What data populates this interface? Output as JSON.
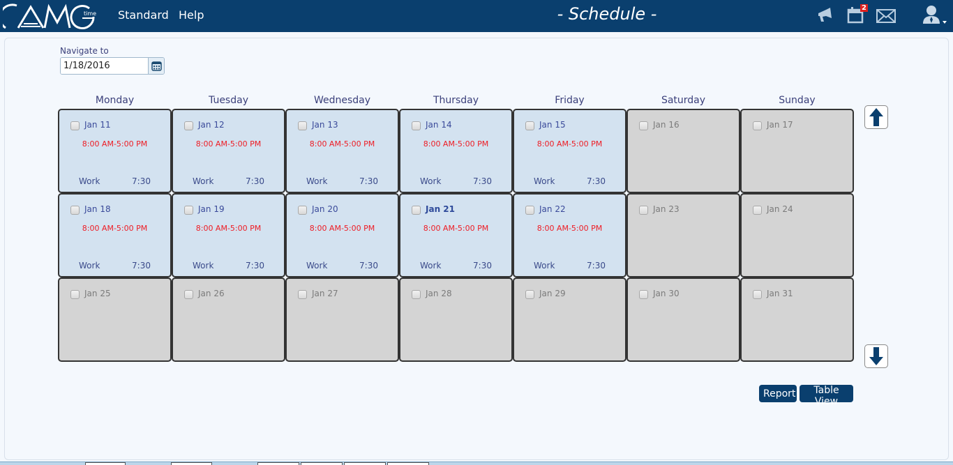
{
  "header": {
    "logo_text": "AMG",
    "logo_sub": "time",
    "nav": [
      "Standard",
      "Help"
    ],
    "title": "- Schedule -",
    "icons": {
      "announcements": "megaphone-icon",
      "calendar": "calendar-icon",
      "calendar_badge": "2",
      "messages": "envelope-icon",
      "user": "user-icon"
    }
  },
  "navigate": {
    "label": "Navigate to",
    "value": "1/18/2016"
  },
  "days": [
    "Monday",
    "Tuesday",
    "Wednesday",
    "Thursday",
    "Friday",
    "Saturday",
    "Sunday"
  ],
  "weeks": [
    [
      {
        "date": "Jan 11",
        "type": "work",
        "shift": "8:00 AM-5:00 PM",
        "wtype": "Work",
        "hours": "7:30"
      },
      {
        "date": "Jan 12",
        "type": "work",
        "shift": "8:00 AM-5:00 PM",
        "wtype": "Work",
        "hours": "7:30"
      },
      {
        "date": "Jan 13",
        "type": "work",
        "shift": "8:00 AM-5:00 PM",
        "wtype": "Work",
        "hours": "7:30"
      },
      {
        "date": "Jan 14",
        "type": "work",
        "shift": "8:00 AM-5:00 PM",
        "wtype": "Work",
        "hours": "7:30"
      },
      {
        "date": "Jan 15",
        "type": "work",
        "shift": "8:00 AM-5:00 PM",
        "wtype": "Work",
        "hours": "7:30"
      },
      {
        "date": "Jan 16",
        "type": "off"
      },
      {
        "date": "Jan 17",
        "type": "off"
      }
    ],
    [
      {
        "date": "Jan 18",
        "type": "work",
        "shift": "8:00 AM-5:00 PM",
        "wtype": "Work",
        "hours": "7:30"
      },
      {
        "date": "Jan 19",
        "type": "work",
        "shift": "8:00 AM-5:00 PM",
        "wtype": "Work",
        "hours": "7:30"
      },
      {
        "date": "Jan 20",
        "type": "work",
        "shift": "8:00 AM-5:00 PM",
        "wtype": "Work",
        "hours": "7:30"
      },
      {
        "date": "Jan 21",
        "type": "work",
        "shift": "8:00 AM-5:00 PM",
        "wtype": "Work",
        "hours": "7:30",
        "today": true
      },
      {
        "date": "Jan 22",
        "type": "work",
        "shift": "8:00 AM-5:00 PM",
        "wtype": "Work",
        "hours": "7:30"
      },
      {
        "date": "Jan 23",
        "type": "off"
      },
      {
        "date": "Jan 24",
        "type": "off"
      }
    ],
    [
      {
        "date": "Jan 25",
        "type": "off"
      },
      {
        "date": "Jan 26",
        "type": "off"
      },
      {
        "date": "Jan 27",
        "type": "off"
      },
      {
        "date": "Jan 28",
        "type": "off"
      },
      {
        "date": "Jan 29",
        "type": "off"
      },
      {
        "date": "Jan 30",
        "type": "off"
      },
      {
        "date": "Jan 31",
        "type": "off"
      }
    ]
  ],
  "buttons": {
    "report": "Report",
    "table_view": "Table View",
    "scroll_up": "arrow-up-icon",
    "scroll_down": "arrow-down-icon"
  },
  "colors": {
    "brand": "#0a3f6e",
    "work_cell": "#d3e2f0",
    "off_cell": "#d4d4d4",
    "shift_text": "#ee1c24"
  }
}
